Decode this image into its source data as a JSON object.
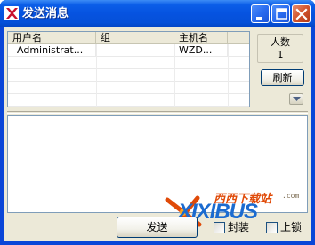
{
  "window": {
    "title": "发送消息"
  },
  "list": {
    "columns": [
      "用户名",
      "组",
      "主机名"
    ],
    "rows": [
      {
        "user": "Administrat...",
        "group": "",
        "host": "WZD..."
      }
    ]
  },
  "count": {
    "label": "人数",
    "value": "1"
  },
  "buttons": {
    "refresh": "刷新",
    "send": "发送"
  },
  "options": {
    "seal_label": "封装",
    "lock_label": "上锁"
  },
  "watermark": {
    "cn_text": "西西下载站",
    "com_text": ".com",
    "brand": "XIXIBUS"
  },
  "colors": {
    "titlebar": "#0653e0",
    "client_bg": "#ece9d8",
    "watermark_orange": "#e04a08",
    "watermark_blue": "#1b6bd0"
  },
  "icons": {
    "app": "app-icon",
    "minimize": "minimize-icon",
    "maximize": "maximize-icon",
    "close": "close-icon",
    "dropdown": "chevron-down-icon"
  }
}
